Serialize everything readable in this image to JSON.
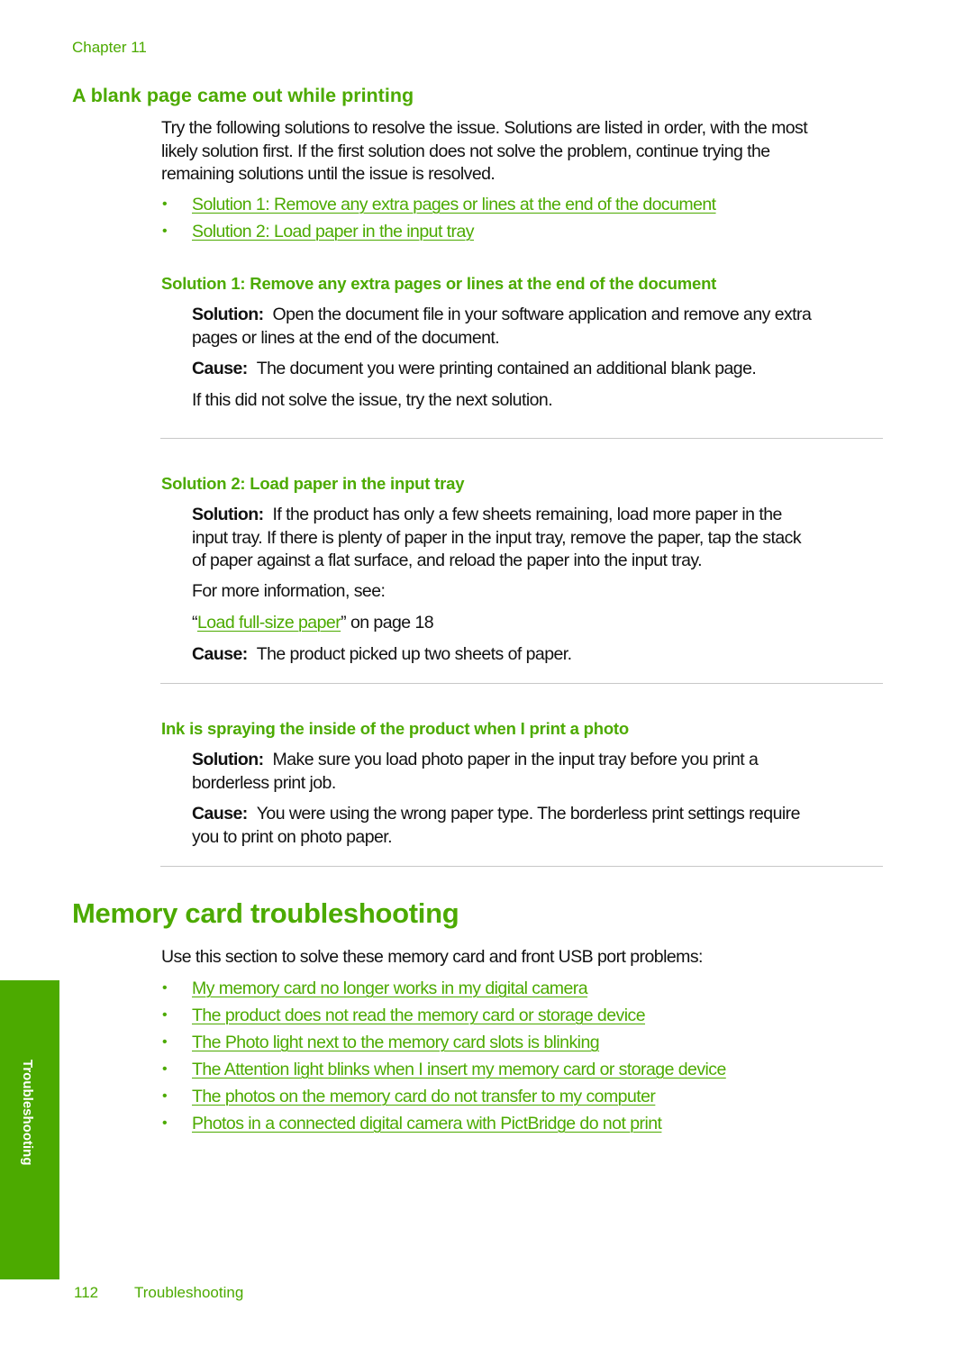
{
  "header": {
    "chapter": "Chapter 11"
  },
  "section_blank_page": {
    "title": "A blank page came out while printing",
    "intro_lines": [
      "Try the following solutions to resolve the issue. Solutions are listed in order, with the most",
      "likely solution first. If the first solution does not solve the problem, continue trying the",
      "remaining solutions until the issue is resolved."
    ],
    "links": [
      "Solution 1: Remove any extra pages or lines at the end of the document",
      "Solution 2: Load paper in the input tray"
    ],
    "solution1": {
      "heading": "Solution 1: Remove any extra pages or lines at the end of the document",
      "solution_label": "Solution:",
      "solution_lines": [
        "Open the document file in your software application and remove any extra",
        "pages or lines at the end of the document."
      ],
      "cause_label": "Cause:",
      "cause_text": "The document you were printing contained an additional blank page.",
      "next_text": "If this did not solve the issue, try the next solution."
    },
    "solution2": {
      "heading": "Solution 2: Load paper in the input tray",
      "solution_label": "Solution:",
      "solution_lines": [
        "If the product has only a few sheets remaining, load more paper in the",
        "input tray. If there is plenty of paper in the input tray, remove the paper, tap the stack",
        "of paper against a flat surface, and reload the paper into the input tray."
      ],
      "more_info": "For more information, see:",
      "xref_open_quote": "“",
      "xref_link": "Load full-size paper",
      "xref_suffix": "” on page 18",
      "cause_label": "Cause:",
      "cause_text": "The product picked up two sheets of paper."
    }
  },
  "section_ink_spraying": {
    "heading": "Ink is spraying the inside of the product when I print a photo",
    "solution_label": "Solution:",
    "solution_lines": [
      "Make sure you load photo paper in the input tray before you print a",
      "borderless print job."
    ],
    "cause_label": "Cause:",
    "cause_lines": [
      "You were using the wrong paper type. The borderless print settings require",
      "you to print on photo paper."
    ]
  },
  "section_memory_card": {
    "title": "Memory card troubleshooting",
    "intro": "Use this section to solve these memory card and front USB port problems:",
    "links": [
      "My memory card no longer works in my digital camera",
      "The product does not read the memory card or storage device",
      "The Photo light next to the memory card slots is blinking",
      "The Attention light blinks when I insert my memory card or storage device",
      "The photos on the memory card do not transfer to my computer",
      "Photos in a connected digital camera with PictBridge do not print"
    ]
  },
  "side_tab": {
    "label": "Troubleshooting"
  },
  "footer": {
    "page_number": "112",
    "section": "Troubleshooting"
  },
  "bullet_glyph": "•",
  "colors": {
    "accent": "#4caa00",
    "rule": "#c8c8c8",
    "text": "#111111"
  }
}
